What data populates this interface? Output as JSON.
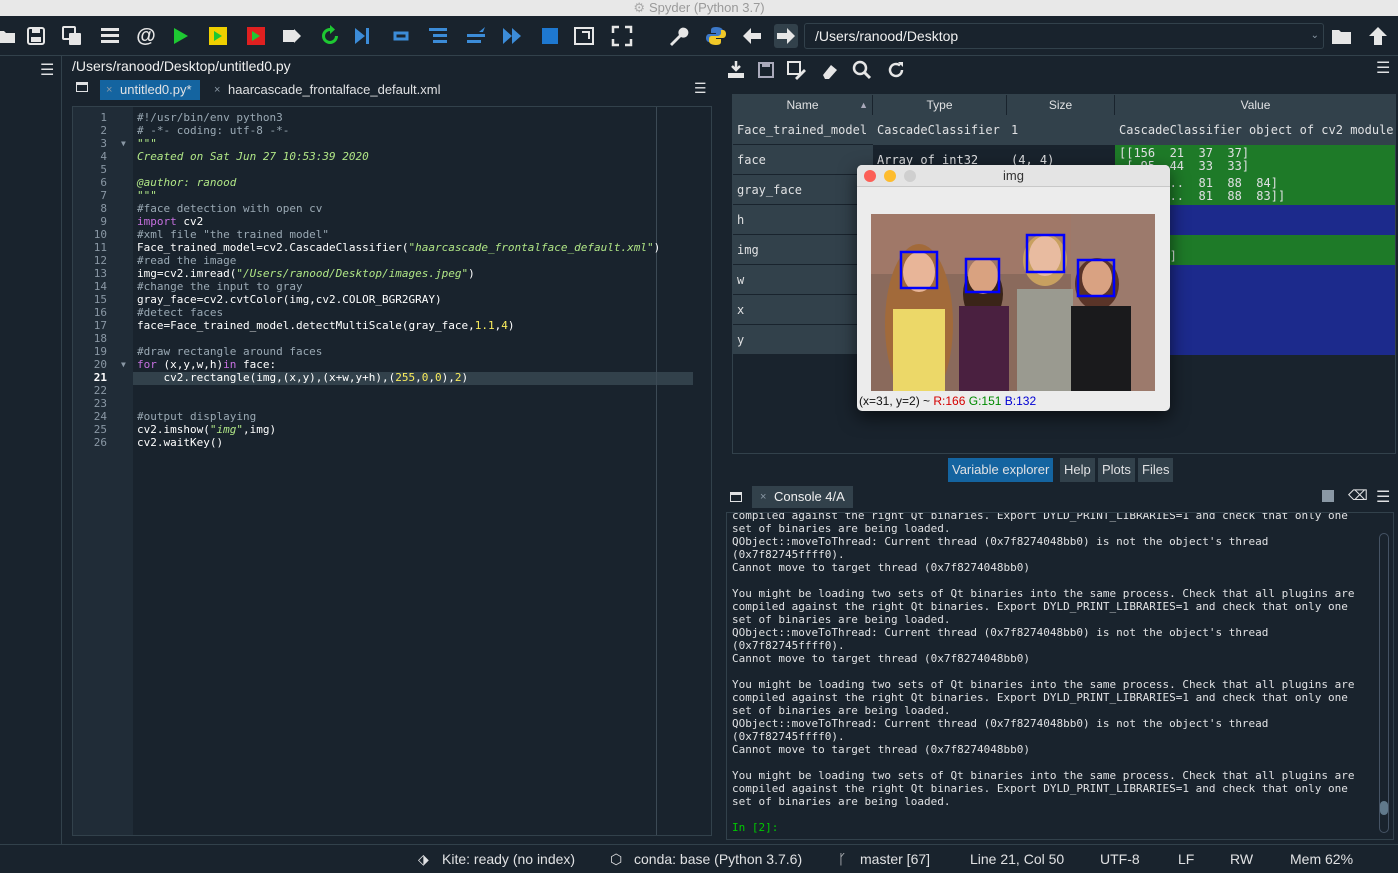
{
  "window": {
    "title": "Spyder (Python 3.7)"
  },
  "toolbar": {
    "path": "/Users/ranood/Desktop"
  },
  "editor": {
    "file_path": "/Users/ranood/Desktop/untitled0.py",
    "tabs": [
      {
        "label": "untitled0.py*",
        "active": true
      },
      {
        "label": "haarcascade_frontalface_default.xml",
        "active": false
      }
    ],
    "current_line": 21
  },
  "variable_explorer": {
    "headers": {
      "name": "Name",
      "type": "Type",
      "size": "Size",
      "value": "Value"
    },
    "rows": [
      {
        "name": "Face_trained_model",
        "type": "CascadeClassifier",
        "size": "1",
        "value": "CascadeClassifier object of cv2 module",
        "value_bg": "#32414b"
      },
      {
        "name": "face",
        "type": "Array of int32",
        "size": "(4, 4)",
        "value": "[[156  21  37  37]\n [ 95  44  33  33]",
        "value_bg": "#1e7a28"
      },
      {
        "name": "gray_face",
        "type": "",
        "size": "",
        "value": "7 157 ...  81  88  84]\n7 157 ...  81  88  83]]",
        "value_bg": "#1e7a28"
      },
      {
        "name": "h",
        "type": "",
        "size": "",
        "value": "",
        "value_bg": "#1c2a8c"
      },
      {
        "name": "img",
        "type": "",
        "size": "",
        "value": "55 171]\n55 171]]",
        "value_bg": "#1e7a28"
      },
      {
        "name": "w",
        "type": "",
        "size": "",
        "value": "",
        "value_bg": "#1c2a8c"
      },
      {
        "name": "x",
        "type": "",
        "size": "",
        "value": "",
        "value_bg": "#1c2a8c"
      },
      {
        "name": "y",
        "type": "",
        "size": "",
        "value": "",
        "value_bg": "#1c2a8c"
      }
    ],
    "tabs": [
      "Variable explorer",
      "Help",
      "Plots",
      "Files"
    ]
  },
  "console": {
    "tab_label": "Console 4/A",
    "lines": [
      "compiled against the right Qt binaries. Export DYLD_PRINT_LIBRARIES=1 and check that only one",
      "set of binaries are being loaded.",
      "QObject::moveToThread: Current thread (0x7f8274048bb0) is not the object's thread",
      "(0x7f82745ffff0).",
      "Cannot move to target thread (0x7f8274048bb0)",
      "",
      "You might be loading two sets of Qt binaries into the same process. Check that all plugins are",
      "compiled against the right Qt binaries. Export DYLD_PRINT_LIBRARIES=1 and check that only one",
      "set of binaries are being loaded.",
      "QObject::moveToThread: Current thread (0x7f8274048bb0) is not the object's thread",
      "(0x7f82745ffff0).",
      "Cannot move to target thread (0x7f8274048bb0)",
      "",
      "You might be loading two sets of Qt binaries into the same process. Check that all plugins are",
      "compiled against the right Qt binaries. Export DYLD_PRINT_LIBRARIES=1 and check that only one",
      "set of binaries are being loaded.",
      "QObject::moveToThread: Current thread (0x7f8274048bb0) is not the object's thread",
      "(0x7f82745ffff0).",
      "Cannot move to target thread (0x7f8274048bb0)",
      "",
      "You might be loading two sets of Qt binaries into the same process. Check that all plugins are",
      "compiled against the right Qt binaries. Export DYLD_PRINT_LIBRARIES=1 and check that only one",
      "set of binaries are being loaded.",
      ""
    ],
    "prompt": "In [2]:"
  },
  "image_window": {
    "title": "img",
    "status_prefix": "(x=31, y=2) ~ ",
    "r": "R:166",
    "g": "G:151",
    "b": "B:132"
  },
  "statusbar": {
    "kite": "Kite: ready (no index)",
    "conda": "conda: base (Python 3.7.6)",
    "git": "master [67]",
    "cursor": "Line 21, Col 50",
    "encoding": "UTF-8",
    "eol": "LF",
    "permissions": "RW",
    "memory": "Mem 62%"
  }
}
